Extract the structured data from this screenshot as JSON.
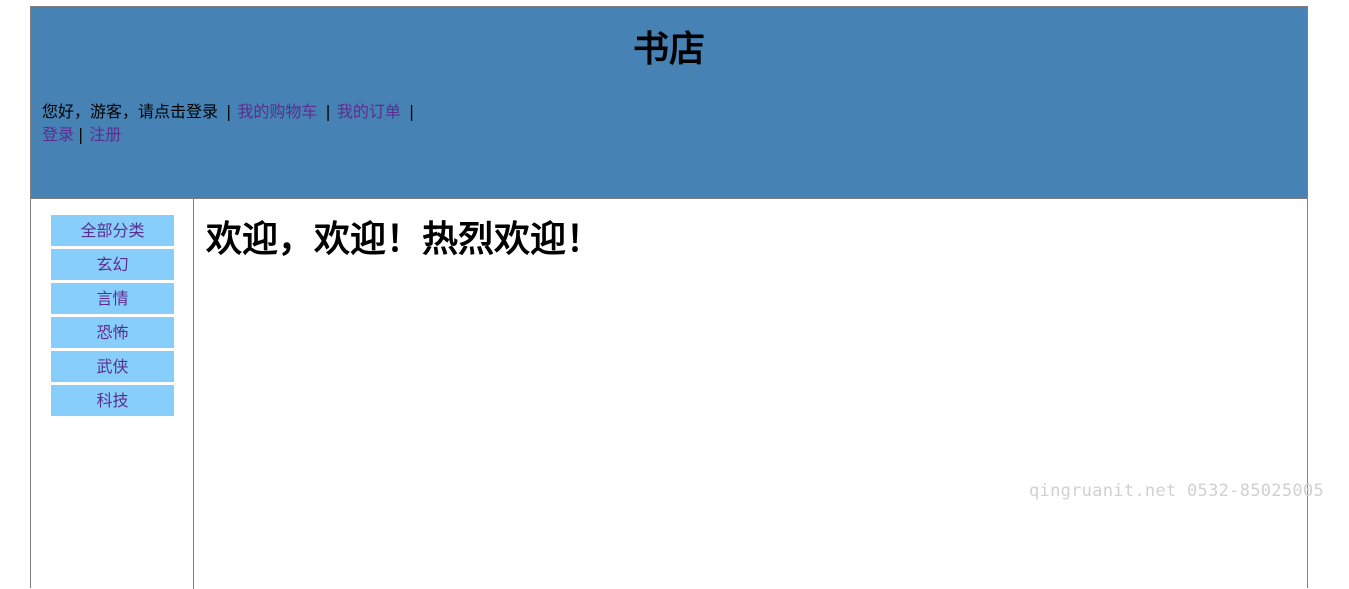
{
  "header": {
    "title": "书店",
    "greeting": "您好，游客，请点击登录",
    "cart_link": "我的购物车",
    "orders_link": "我的订单",
    "login_link": "登录",
    "register_link": "注册",
    "separator": "|"
  },
  "sidebar": {
    "categories": [
      {
        "label": "全部分类"
      },
      {
        "label": "玄幻"
      },
      {
        "label": "言情"
      },
      {
        "label": "恐怖"
      },
      {
        "label": "武侠"
      },
      {
        "label": "科技"
      }
    ]
  },
  "main": {
    "welcome": "欢迎，欢迎！热烈欢迎！"
  },
  "watermark": {
    "text": "qingruanit.net 0532-85025005"
  },
  "colors": {
    "header_bg": "#4682b4",
    "category_bg": "#87cefa",
    "link": "#5c2d91"
  }
}
